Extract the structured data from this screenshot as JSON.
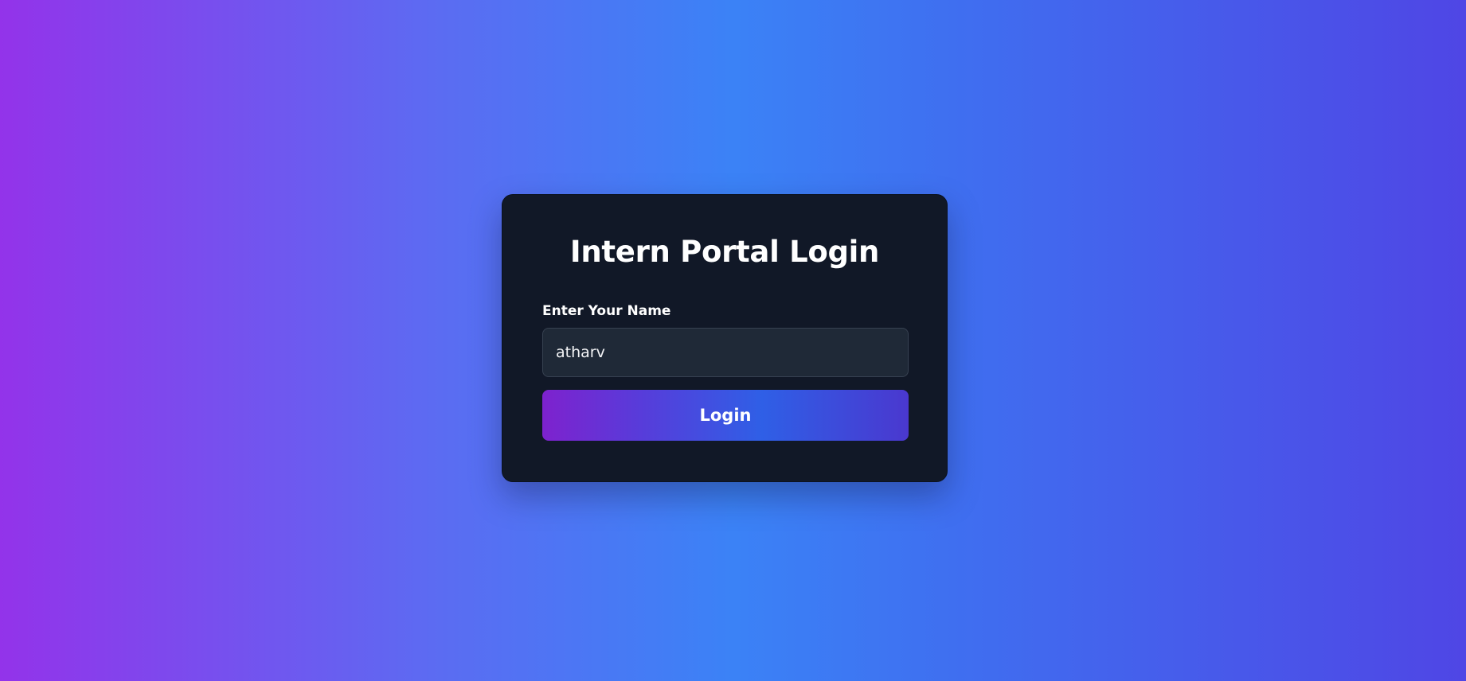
{
  "login_card": {
    "title": "Intern Portal Login",
    "name_label": "Enter Your Name",
    "name_value": "atharv",
    "login_button": "Login"
  },
  "colors": {
    "background_start": "#9333ea",
    "background_mid": "#3b82f6",
    "background_end": "#4f46e5",
    "card": "#111827",
    "input": "#1f2937"
  }
}
